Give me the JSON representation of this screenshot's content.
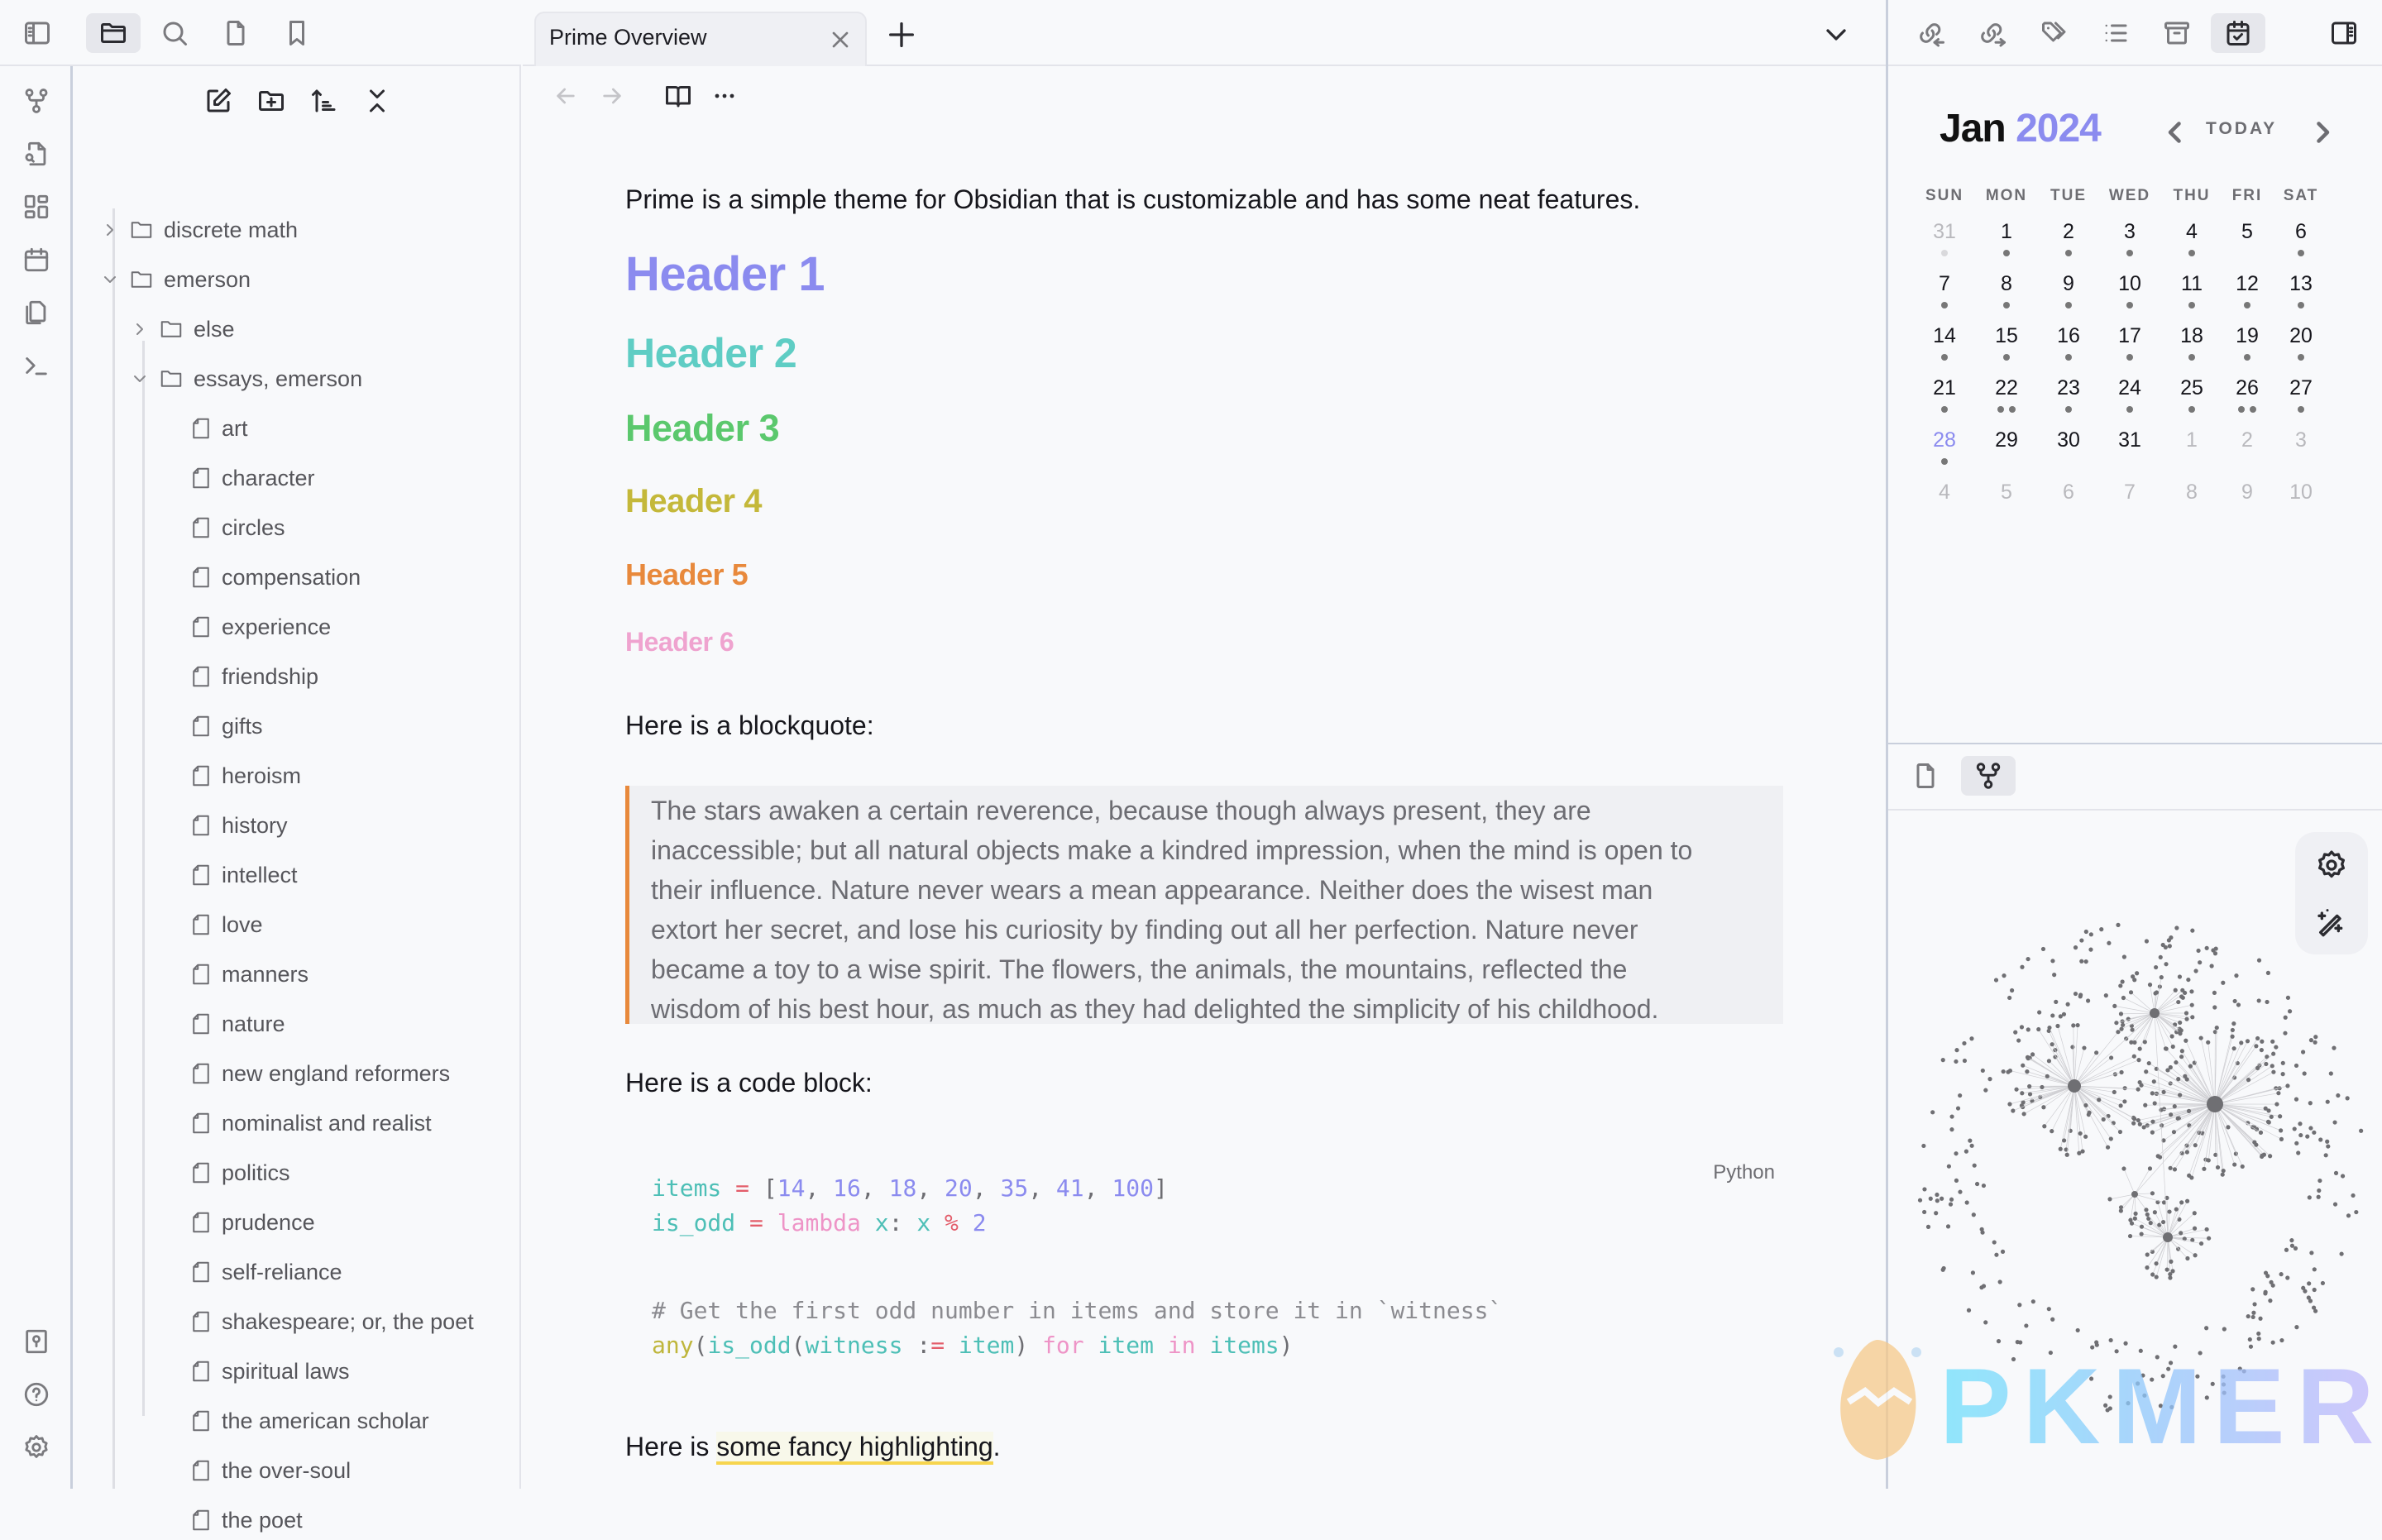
{
  "left_toolbar": {
    "buttons": [
      {
        "name": "toggle-left-sidebar",
        "icon": "sidebar-left-icon"
      },
      {
        "name": "files",
        "icon": "folder-icon",
        "active": true
      },
      {
        "name": "search",
        "icon": "search-icon"
      },
      {
        "name": "file",
        "icon": "file-icon"
      },
      {
        "name": "bookmarks",
        "icon": "bookmark-icon"
      }
    ]
  },
  "ribbon": {
    "top": [
      "graph-view-icon",
      "file-search-icon",
      "dashboard-icon",
      "calendar-icon",
      "copy-icon",
      "terminal-icon"
    ],
    "bottom": [
      "vault-icon",
      "help-icon",
      "settings-icon"
    ]
  },
  "explorer": {
    "actions": [
      "new-note",
      "new-folder",
      "sort",
      "collapse-all"
    ],
    "tree": [
      {
        "label": "discrete math",
        "type": "folder",
        "depth": 0,
        "expanded": false
      },
      {
        "label": "emerson",
        "type": "folder",
        "depth": 0,
        "expanded": true
      },
      {
        "label": "else",
        "type": "folder",
        "depth": 1,
        "expanded": false
      },
      {
        "label": "essays, emerson",
        "type": "folder",
        "depth": 1,
        "expanded": true
      },
      {
        "label": "art",
        "type": "file",
        "depth": 2
      },
      {
        "label": "character",
        "type": "file",
        "depth": 2
      },
      {
        "label": "circles",
        "type": "file",
        "depth": 2
      },
      {
        "label": "compensation",
        "type": "file",
        "depth": 2
      },
      {
        "label": "experience",
        "type": "file",
        "depth": 2
      },
      {
        "label": "friendship",
        "type": "file",
        "depth": 2
      },
      {
        "label": "gifts",
        "type": "file",
        "depth": 2
      },
      {
        "label": "heroism",
        "type": "file",
        "depth": 2
      },
      {
        "label": "history",
        "type": "file",
        "depth": 2
      },
      {
        "label": "intellect",
        "type": "file",
        "depth": 2
      },
      {
        "label": "love",
        "type": "file",
        "depth": 2
      },
      {
        "label": "manners",
        "type": "file",
        "depth": 2
      },
      {
        "label": "nature",
        "type": "file",
        "depth": 2
      },
      {
        "label": "new england reformers",
        "type": "file",
        "depth": 2
      },
      {
        "label": "nominalist and realist",
        "type": "file",
        "depth": 2
      },
      {
        "label": "politics",
        "type": "file",
        "depth": 2
      },
      {
        "label": "prudence",
        "type": "file",
        "depth": 2
      },
      {
        "label": "self-reliance",
        "type": "file",
        "depth": 2
      },
      {
        "label": "shakespeare; or, the poet",
        "type": "file",
        "depth": 2
      },
      {
        "label": "spiritual laws",
        "type": "file",
        "depth": 2
      },
      {
        "label": "the american scholar",
        "type": "file",
        "depth": 2
      },
      {
        "label": "the over-soul",
        "type": "file",
        "depth": 2
      },
      {
        "label": "the poet",
        "type": "file",
        "depth": 2
      }
    ]
  },
  "tabs": [
    {
      "title": "Prime Overview",
      "active": true
    }
  ],
  "editor": {
    "intro": "Prime is a simple theme for Obsidian that is customizable and has some neat features.",
    "headers": [
      {
        "text": "Header 1",
        "color": "#8b8bef"
      },
      {
        "text": "Header 2",
        "color": "#5fcdc4"
      },
      {
        "text": "Header 3",
        "color": "#5bc86d"
      },
      {
        "text": "Header 4",
        "color": "#c4b83a"
      },
      {
        "text": "Header 5",
        "color": "#e8893c"
      },
      {
        "text": "Header 6",
        "color": "#efa3cf"
      }
    ],
    "blockquote_label": "Here is a blockquote:",
    "blockquote_lines": [
      "The stars awaken a certain reverence, because though always present, they are",
      "inaccessible; but all natural objects make a kindred impression, when the mind is open to",
      "their influence. Nature never wears a mean appearance. Neither does the wisest man",
      "extort her secret, and lose his curiosity by finding out all her perfection. Nature never",
      "became a toy to a wise spirit. The flowers, the animals, the mountains, reflected the",
      "wisdom of his best hour, as much as they had delighted the simplicity of his childhood."
    ],
    "codeblock_label": "Here is a code block:",
    "code_language": "Python",
    "code_lines": [
      [
        [
          "c-var",
          "items"
        ],
        [
          "c-pu",
          " "
        ],
        [
          "c-op",
          "="
        ],
        [
          "c-pu",
          " ["
        ],
        [
          "c-num",
          "14"
        ],
        [
          "c-pu",
          ", "
        ],
        [
          "c-num",
          "16"
        ],
        [
          "c-pu",
          ", "
        ],
        [
          "c-num",
          "18"
        ],
        [
          "c-pu",
          ", "
        ],
        [
          "c-num",
          "20"
        ],
        [
          "c-pu",
          ", "
        ],
        [
          "c-num",
          "35"
        ],
        [
          "c-pu",
          ", "
        ],
        [
          "c-num",
          "41"
        ],
        [
          "c-pu",
          ", "
        ],
        [
          "c-num",
          "100"
        ],
        [
          "c-pu",
          "]"
        ]
      ],
      [
        [
          "c-var",
          "is_odd"
        ],
        [
          "c-pu",
          " "
        ],
        [
          "c-op",
          "="
        ],
        [
          "c-pu",
          " "
        ],
        [
          "c-kw",
          "lambda"
        ],
        [
          "c-pu",
          " "
        ],
        [
          "c-var",
          "x"
        ],
        [
          "c-pu",
          ": "
        ],
        [
          "c-var",
          "x"
        ],
        [
          "c-pu",
          " "
        ],
        [
          "c-op",
          "%"
        ],
        [
          "c-pu",
          " "
        ],
        [
          "c-num",
          "2"
        ]
      ],
      [],
      [
        [
          "c-cm",
          "# Get the first odd number in items and store it in `witness`"
        ]
      ],
      [
        [
          "c-fn",
          "any"
        ],
        [
          "c-pu",
          "("
        ],
        [
          "c-var",
          "is_odd"
        ],
        [
          "c-pu",
          "("
        ],
        [
          "c-var",
          "witness"
        ],
        [
          "c-pu",
          " :"
        ],
        [
          "c-op",
          "="
        ],
        [
          "c-pu",
          " "
        ],
        [
          "c-var",
          "item"
        ],
        [
          "c-pu",
          ") "
        ],
        [
          "c-kw",
          "for"
        ],
        [
          "c-pu",
          " "
        ],
        [
          "c-var",
          "item"
        ],
        [
          "c-pu",
          " "
        ],
        [
          "c-kw",
          "in"
        ],
        [
          "c-pu",
          " "
        ],
        [
          "c-var",
          "items"
        ],
        [
          "c-pu",
          ")"
        ]
      ]
    ],
    "highlight_prefix": "Here is ",
    "highlight_text": "some fancy highlighting",
    "highlight_suffix": "."
  },
  "right_toolbar": {
    "buttons": [
      "backlinks-icon",
      "outgoing-links-icon",
      "tags-icon",
      "outline-icon",
      "archive-icon",
      "calendar-check-icon"
    ],
    "active": "calendar-check-icon"
  },
  "calendar": {
    "month": "Jan",
    "year": "2024",
    "today_label": "TODAY",
    "weekdays": [
      "SUN",
      "MON",
      "TUE",
      "WED",
      "THU",
      "FRI",
      "SAT"
    ],
    "weeks": [
      [
        {
          "d": "31",
          "other": true,
          "dots": 1
        },
        {
          "d": "1",
          "dots": 1
        },
        {
          "d": "2",
          "dots": 1
        },
        {
          "d": "3",
          "dots": 1
        },
        {
          "d": "4",
          "dots": 1
        },
        {
          "d": "5",
          "dots": 0
        },
        {
          "d": "6",
          "dots": 1
        }
      ],
      [
        {
          "d": "7",
          "dots": 1
        },
        {
          "d": "8",
          "dots": 1
        },
        {
          "d": "9",
          "dots": 1
        },
        {
          "d": "10",
          "dots": 1
        },
        {
          "d": "11",
          "dots": 1
        },
        {
          "d": "12",
          "dots": 1
        },
        {
          "d": "13",
          "dots": 1
        }
      ],
      [
        {
          "d": "14",
          "dots": 1
        },
        {
          "d": "15",
          "dots": 1
        },
        {
          "d": "16",
          "dots": 1
        },
        {
          "d": "17",
          "dots": 1
        },
        {
          "d": "18",
          "dots": 1
        },
        {
          "d": "19",
          "dots": 1
        },
        {
          "d": "20",
          "dots": 1
        }
      ],
      [
        {
          "d": "21",
          "dots": 1
        },
        {
          "d": "22",
          "dots": 2
        },
        {
          "d": "23",
          "dots": 1
        },
        {
          "d": "24",
          "dots": 1
        },
        {
          "d": "25",
          "dots": 1
        },
        {
          "d": "26",
          "dots": 2
        },
        {
          "d": "27",
          "dots": 1
        }
      ],
      [
        {
          "d": "28",
          "today": true,
          "dots": 1
        },
        {
          "d": "29",
          "dots": 0
        },
        {
          "d": "30",
          "dots": 0
        },
        {
          "d": "31",
          "dots": 0
        },
        {
          "d": "1",
          "other": true,
          "dots": 0
        },
        {
          "d": "2",
          "other": true,
          "dots": 0
        },
        {
          "d": "3",
          "other": true,
          "dots": 0
        }
      ],
      [
        {
          "d": "4",
          "other": true,
          "dots": 0
        },
        {
          "d": "5",
          "other": true,
          "dots": 0
        },
        {
          "d": "6",
          "other": true,
          "dots": 0
        },
        {
          "d": "7",
          "other": true,
          "dots": 0
        },
        {
          "d": "8",
          "other": true,
          "dots": 0
        },
        {
          "d": "9",
          "other": true,
          "dots": 0
        },
        {
          "d": "10",
          "other": true,
          "dots": 0
        }
      ]
    ]
  },
  "right_bottom": {
    "tabs": [
      "file-icon",
      "graph-view-icon"
    ],
    "active": "graph-view-icon",
    "graph_controls": [
      "settings-icon",
      "magic-wand-icon"
    ]
  },
  "watermark": {
    "text": "PKMER"
  },
  "colors": {
    "accent": "#8b8bef",
    "blockquote_border": "#e8893c",
    "highlight_underline": "#f7d54e"
  }
}
